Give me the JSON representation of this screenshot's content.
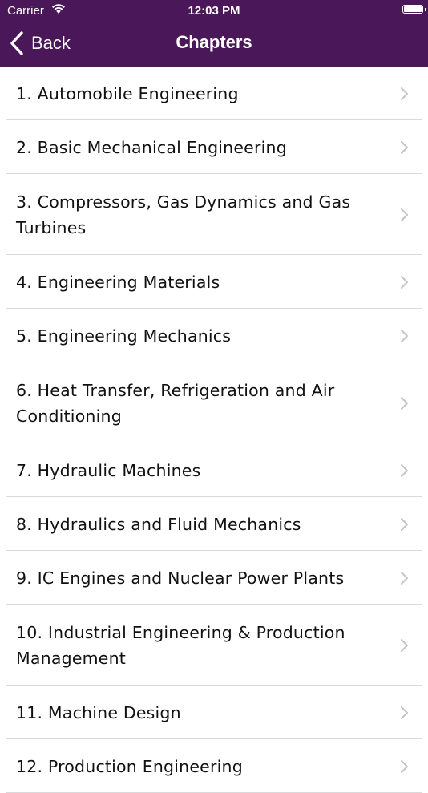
{
  "status_bar": {
    "carrier": "Carrier",
    "time": "12:03 PM",
    "wifi_icon": "wifi-icon",
    "battery_icon": "battery-icon"
  },
  "nav": {
    "back_label": "Back",
    "title": "Chapters",
    "back_icon": "chevron-left-icon",
    "bar_color": "#4a1858"
  },
  "chapters": [
    {
      "label": "1. Automobile Engineering"
    },
    {
      "label": "2. Basic Mechanical Engineering"
    },
    {
      "label": "3. Compressors, Gas Dynamics and Gas Turbines"
    },
    {
      "label": "4. Engineering Materials"
    },
    {
      "label": "5. Engineering Mechanics"
    },
    {
      "label": "6. Heat Transfer, Refrigeration and Air Conditioning"
    },
    {
      "label": "7. Hydraulic Machines"
    },
    {
      "label": "8. Hydraulics and Fluid Mechanics"
    },
    {
      "label": "9. IC Engines and Nuclear Power Plants"
    },
    {
      "label": "10. Industrial Engineering & Production Management"
    },
    {
      "label": "11. Machine Design"
    },
    {
      "label": "12. Production Engineering"
    }
  ],
  "row_icon": "chevron-right-icon"
}
